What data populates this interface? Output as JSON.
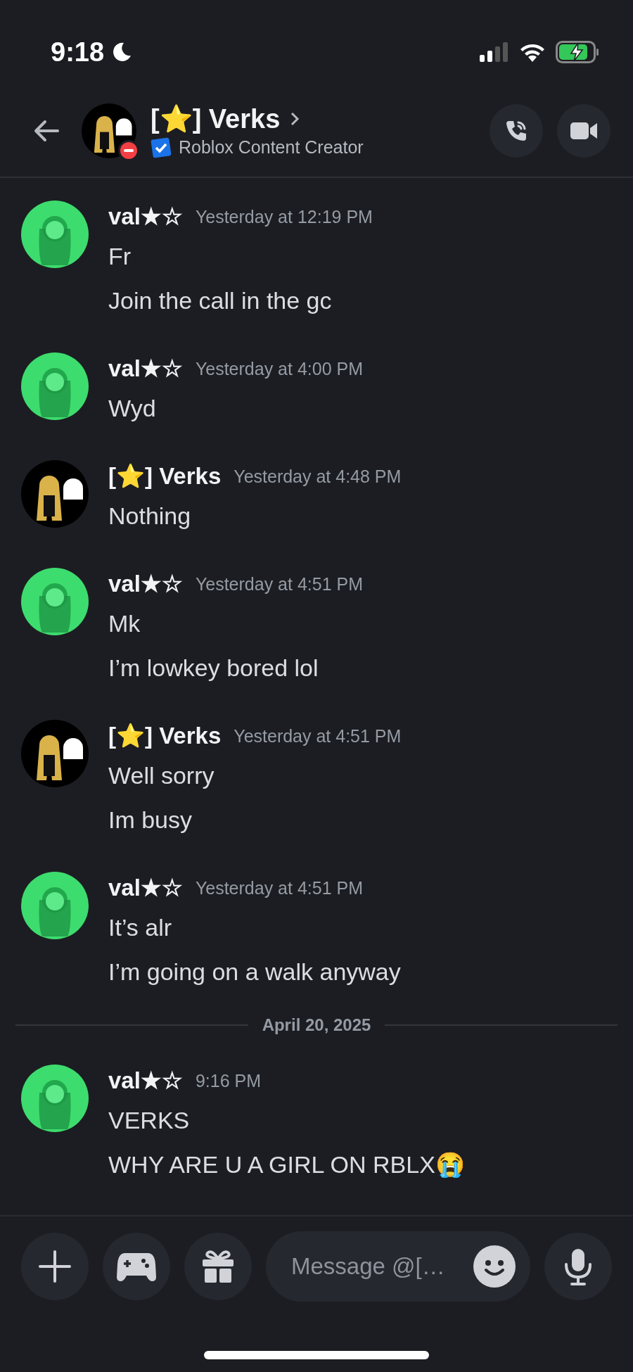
{
  "status_bar": {
    "time": "9:18"
  },
  "header": {
    "title": "[⭐] Verks",
    "subtitle": "Roblox Content Creator",
    "do_not_disturb": true,
    "verified": true
  },
  "messages": [
    {
      "kind": "group",
      "author": "val★☆",
      "color": "#3ddc6e",
      "time": "Yesterday at 12:19 PM",
      "lines": [
        "Fr",
        "Join the call in the gc"
      ]
    },
    {
      "kind": "group",
      "author": "val★☆",
      "color": "#3ddc6e",
      "time": "Yesterday at 4:00 PM",
      "lines": [
        "Wyd"
      ]
    },
    {
      "kind": "group",
      "author": "[⭐] Verks",
      "color": "#000000",
      "time": "Yesterday at 4:48 PM",
      "lines": [
        "Nothing"
      ]
    },
    {
      "kind": "group",
      "author": "val★☆",
      "color": "#3ddc6e",
      "time": "Yesterday at 4:51 PM",
      "lines": [
        "Mk",
        "I’m lowkey bored lol"
      ]
    },
    {
      "kind": "group",
      "author": "[⭐] Verks",
      "color": "#000000",
      "time": "Yesterday at 4:51 PM",
      "lines": [
        "Well sorry",
        "Im busy"
      ]
    },
    {
      "kind": "group",
      "author": "val★☆",
      "color": "#3ddc6e",
      "time": "Yesterday at 4:51 PM",
      "lines": [
        "It’s alr",
        "I’m going on a walk anyway"
      ]
    },
    {
      "kind": "date",
      "label": "April 20, 2025"
    },
    {
      "kind": "group",
      "author": "val★☆",
      "color": "#3ddc6e",
      "time": "9:16 PM",
      "lines": [
        "VERKS",
        "WHY ARE U A GIRL ON RBLX😭"
      ]
    }
  ],
  "composer": {
    "placeholder": "Message @[…"
  }
}
